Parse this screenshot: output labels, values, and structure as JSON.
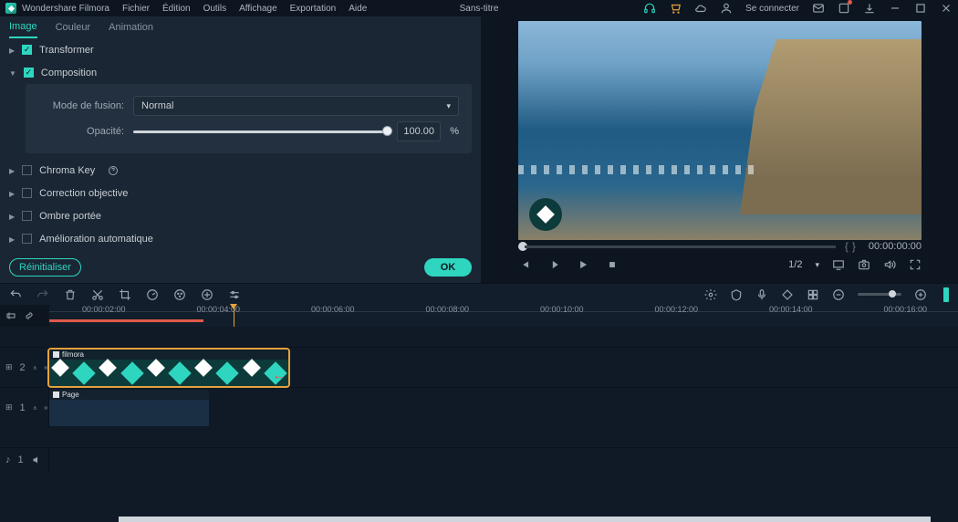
{
  "app": {
    "name": "Wondershare Filmora",
    "doc_title": "Sans-titre",
    "connect": "Se connecter"
  },
  "menu": {
    "file": "Fichier",
    "edit": "Édition",
    "tools": "Outils",
    "view": "Affichage",
    "export": "Exportation",
    "help": "Aide"
  },
  "tabs": {
    "image": "Image",
    "color": "Couleur",
    "animation": "Animation"
  },
  "props": {
    "transformer": "Transformer",
    "composition": "Composition",
    "blend_label": "Mode de fusion:",
    "blend_value": "Normal",
    "opacity_label": "Opacité:",
    "opacity_value": "100.00",
    "opacity_unit": "%",
    "chroma": "Chroma Key",
    "correction": "Correction objective",
    "shadow": "Ombre portée",
    "autoenh": "Amélioration automatique"
  },
  "buttons": {
    "reset": "Réinitialiser",
    "ok": "OK"
  },
  "preview": {
    "timecode": "00:00:00:00",
    "page": "1/2"
  },
  "timeline": {
    "ticks": [
      "00:00:02:00",
      "00:00:04:00",
      "00:00:06:00",
      "00:00:08:00",
      "00:00:10:00",
      "00:00:12:00",
      "00:00:14:00",
      "00:00:16:00"
    ],
    "clip1_name": "filmora",
    "clip2_name": "Page",
    "track2_label": "2",
    "track1_label": "1",
    "audio_label": "1"
  }
}
